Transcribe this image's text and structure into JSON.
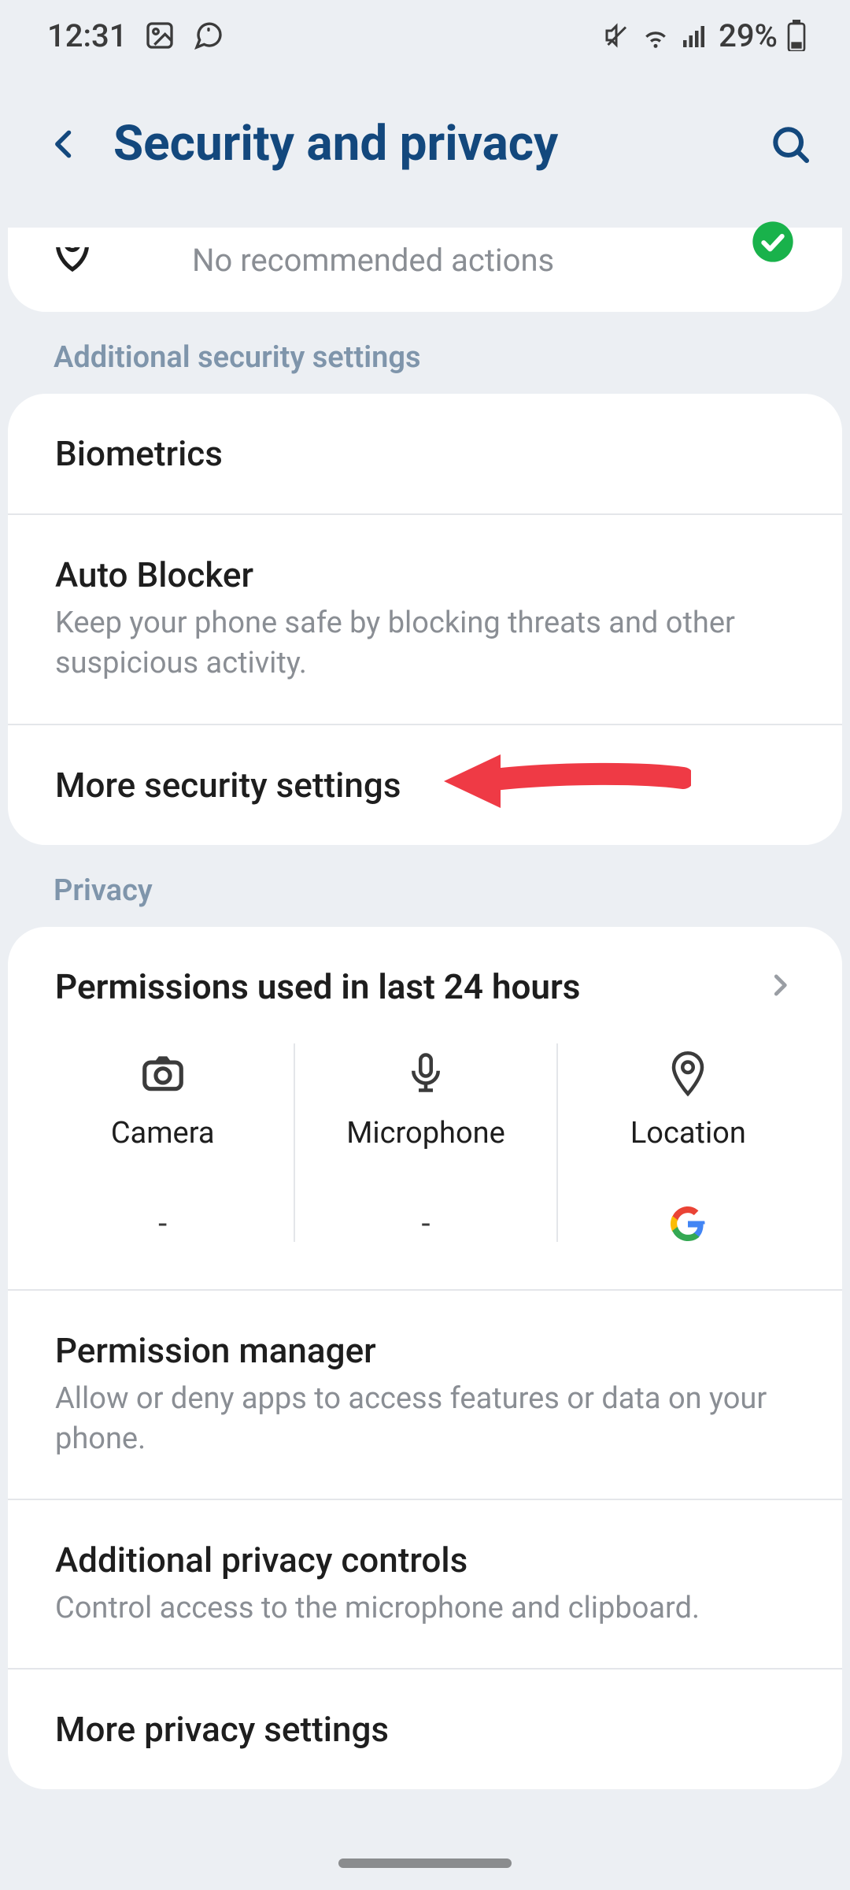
{
  "status": {
    "time": "12:31",
    "battery_pct": "29%"
  },
  "header": {
    "title": "Security and privacy"
  },
  "top_card": {
    "subtitle": "No recommended actions"
  },
  "sections": {
    "additional_security": {
      "label": "Additional security settings",
      "items": [
        {
          "title": "Biometrics"
        },
        {
          "title": "Auto Blocker",
          "sub": "Keep your phone safe by blocking threats and other suspicious activity."
        },
        {
          "title": "More security settings"
        }
      ]
    },
    "privacy": {
      "label": "Privacy",
      "permissions_card": {
        "title": "Permissions used in last 24 hours",
        "cols": [
          {
            "name": "Camera",
            "value": "-"
          },
          {
            "name": "Microphone",
            "value": "-"
          },
          {
            "name": "Location",
            "value": "google"
          }
        ]
      },
      "items": [
        {
          "title": "Permission manager",
          "sub": "Allow or deny apps to access features or data on your phone."
        },
        {
          "title": "Additional privacy controls",
          "sub": "Control access to the microphone and clipboard."
        },
        {
          "title": "More privacy settings"
        }
      ]
    }
  },
  "annotation": {
    "arrow_target": "more-security-settings"
  }
}
